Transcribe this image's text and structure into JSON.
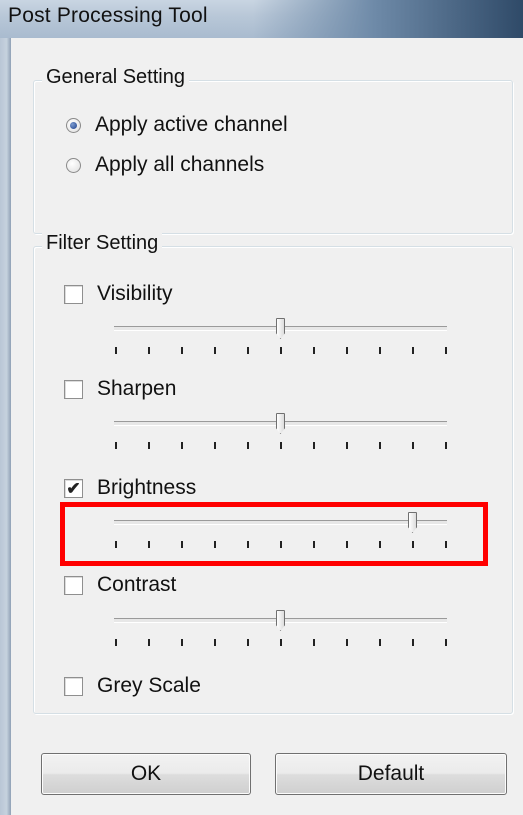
{
  "window": {
    "title": "Post Processing Tool"
  },
  "general_setting": {
    "legend": "General Setting",
    "options": [
      {
        "label": "Apply active channel",
        "selected": true
      },
      {
        "label": "Apply all channels",
        "selected": false
      }
    ]
  },
  "filter_setting": {
    "legend": "Filter Setting",
    "filters": [
      {
        "label": "Visibility",
        "checked": false,
        "slider_level": 0.5
      },
      {
        "label": "Sharpen",
        "checked": false,
        "slider_level": 0.5
      },
      {
        "label": "Brightness",
        "checked": true,
        "slider_level": 0.9
      },
      {
        "label": "Contrast",
        "checked": false,
        "slider_level": 0.5
      },
      {
        "label": "Grey Scale",
        "checked": false
      }
    ]
  },
  "buttons": {
    "ok": "OK",
    "default": "Default"
  },
  "annotation": {
    "highlight_color": "#ff0000",
    "highlighted": "brightness-slider"
  },
  "colors": {
    "title_gradient_end": "#2f4a68",
    "client_bg": "#f0f0f0"
  }
}
